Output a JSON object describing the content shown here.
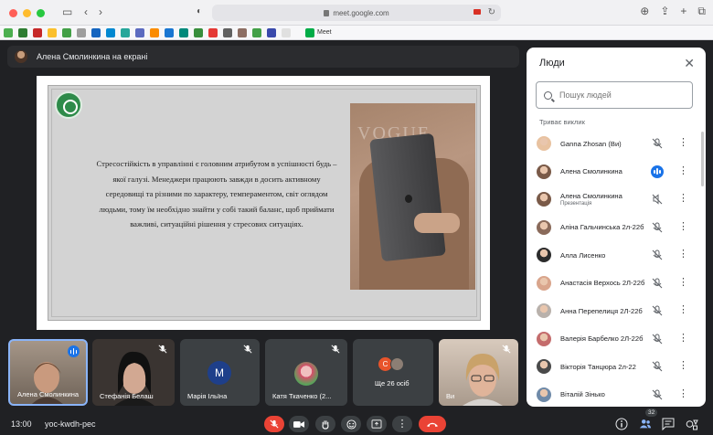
{
  "browser": {
    "url": "meet.google.com",
    "bookmark_tab_label": "Meet"
  },
  "presenter": {
    "label": "Алена Смолинкина на екрані"
  },
  "slide": {
    "body": "Стресостійкість в управлінні є головним атрибутом в успішності будь – якої галузі. Менеджери працюють завжди в досить активному середовищі та різними по характеру, темпераментом, світ оглядом людьми, тому їм необхідно знайти у собі такий баланс, щоб приймати важливі, ситуаційні рішення у стресових ситуаціях.",
    "photo_text": "VOGUE"
  },
  "people_panel": {
    "title": "Люди",
    "search_placeholder": "Пошук людей",
    "section": "Триває виклик",
    "participants": [
      {
        "name": "Ganna Zhosan (Ви)",
        "sub": "",
        "mic": "muted",
        "avatar_color": "#e8c2a0"
      },
      {
        "name": "Алена Смолинкина",
        "sub": "",
        "mic": "speaking",
        "avatar_color": "#7a5a48"
      },
      {
        "name": "Алена Смолинкина",
        "sub": "Презентація",
        "mic": "presenting",
        "avatar_color": "#7a5a48"
      },
      {
        "name": "Аліна Гальчинська 2л-22б",
        "sub": "",
        "mic": "muted",
        "avatar_color": "#8a6a5a"
      },
      {
        "name": "Алла Лисенко",
        "sub": "",
        "mic": "muted",
        "avatar_color": "#2c2c2c"
      },
      {
        "name": "Анастасія Верхось 2Л-22б",
        "sub": "",
        "mic": "muted",
        "avatar_color": "#d9a58c"
      },
      {
        "name": "Анна Перепелиця 2Л-22б",
        "sub": "",
        "mic": "muted",
        "avatar_color": "#b9b1ab"
      },
      {
        "name": "Валерія Барбелко 2Л-22б",
        "sub": "",
        "mic": "muted",
        "avatar_color": "#c46c6c"
      },
      {
        "name": "Вікторія Танцюра 2л-22",
        "sub": "",
        "mic": "muted",
        "avatar_color": "#4a4a4a"
      },
      {
        "name": "Віталій Зінько",
        "sub": "",
        "mic": "muted",
        "avatar_color": "#6f8aa8"
      }
    ]
  },
  "tiles": [
    {
      "name": "Алена Смолинкина",
      "bg": "#8b7f74"
    },
    {
      "name": "Стефанія Белаш",
      "bg": "#2e2b2a"
    },
    {
      "name": "Марія Ільїна",
      "initial": "M",
      "bg": "#3c4043"
    },
    {
      "name": "Катя Ткаченко (2...",
      "bg": "#3c4043"
    },
    {
      "name": "Ще 26 осіб",
      "bg": "#3c4043"
    },
    {
      "name": "Ви",
      "bg": "#c9b9a8"
    }
  ],
  "bottom_bar": {
    "time": "13:00",
    "meeting_code": "yoc-kwdh-pec",
    "people_count": "32"
  },
  "colors": {
    "accent": "#1a73e8",
    "danger": "#ea4335",
    "surface": "#202124",
    "tile": "#3c4043"
  }
}
